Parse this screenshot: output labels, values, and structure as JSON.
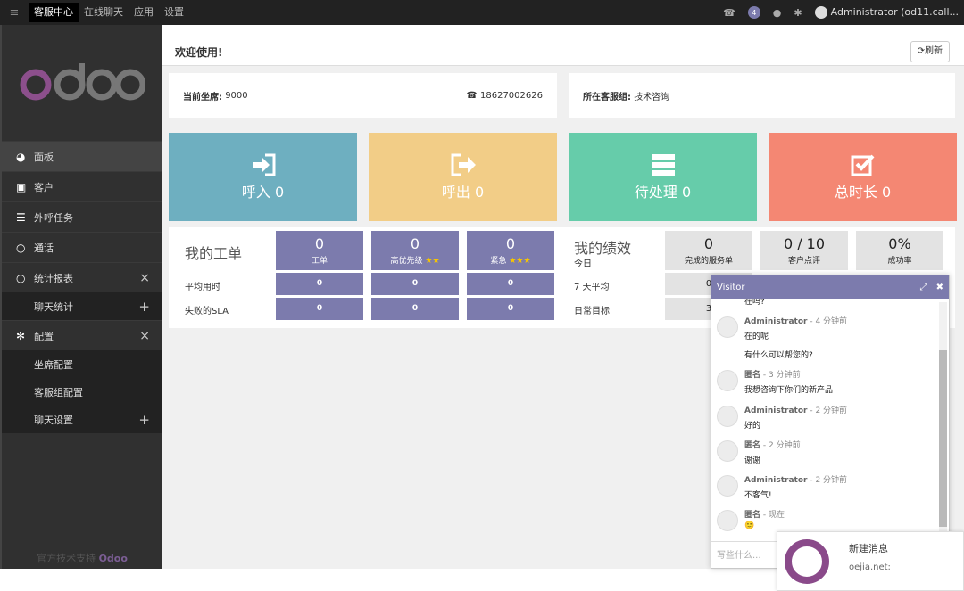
{
  "topbar": {
    "apps": [
      "客服中心",
      "在线聊天",
      "应用",
      "设置"
    ],
    "badge_count": "4",
    "user": "Administrator (od11.call..."
  },
  "sidebar": {
    "logo": "odoo",
    "items": [
      {
        "label": "面板",
        "icon": "dashboard-icon"
      },
      {
        "label": "客户",
        "icon": "contact-icon"
      },
      {
        "label": "外呼任务",
        "icon": "list-icon"
      },
      {
        "label": "通话",
        "icon": "circle-icon"
      },
      {
        "label": "统计报表",
        "icon": "circle-icon",
        "action": "×"
      },
      {
        "label": "聊天统计",
        "sub": true,
        "action": "+"
      },
      {
        "label": "配置",
        "icon": "gear-icon",
        "action": "×"
      },
      {
        "label": "坐席配置",
        "sub": true
      },
      {
        "label": "客服组配置",
        "sub": true
      },
      {
        "label": "聊天设置",
        "sub": true,
        "action": "+"
      }
    ],
    "footer_prefix": "官方技术支持",
    "footer_brand": "Odoo"
  },
  "main": {
    "title": "欢迎使用!",
    "refresh_label": "刷新",
    "seat_label": "当前坐席:",
    "seat_value": "9000",
    "phone": "18627002626",
    "group_label": "所在客服组:",
    "group_value": "技术咨询"
  },
  "tiles": [
    {
      "label": "呼入 0",
      "color": "#6eafc0"
    },
    {
      "label": "呼出 0",
      "color": "#f2cd87"
    },
    {
      "label": "待处理 0",
      "color": "#66ccaa"
    },
    {
      "label": "总时长 0",
      "color": "#f48773"
    }
  ],
  "tickets": {
    "title": "我的工单",
    "columns": [
      {
        "value": "0",
        "label": "工单",
        "stars": ""
      },
      {
        "value": "0",
        "label": "高优先级",
        "stars": "★★"
      },
      {
        "value": "0",
        "label": "紧急",
        "stars": "★★★"
      }
    ],
    "rows": [
      {
        "label": "平均用时",
        "values": [
          "0",
          "0",
          "0"
        ]
      },
      {
        "label": "失败的SLA",
        "values": [
          "0",
          "0",
          "0"
        ]
      }
    ]
  },
  "performance": {
    "title": "我的绩效",
    "today": "今日",
    "columns": [
      {
        "value": "0",
        "label": "完成的服务单"
      },
      {
        "value": "0 / 10",
        "label": "客户点评"
      },
      {
        "value": "0%",
        "label": "成功率"
      }
    ],
    "rows": [
      {
        "label": "7 天平均",
        "values": [
          "0"
        ]
      },
      {
        "label": "日常目标",
        "values": [
          "3"
        ]
      }
    ]
  },
  "chat": {
    "title": "Visitor",
    "partial_text": "在吗?",
    "messages": [
      {
        "author": "Administrator",
        "time": "4 分钟前",
        "lines": [
          "在的呢",
          "有什么可以帮您的?"
        ]
      },
      {
        "author": "匿名",
        "time": "3 分钟前",
        "lines": [
          "我想咨询下你们的新产品"
        ]
      },
      {
        "author": "Administrator",
        "time": "2 分钟前",
        "lines": [
          "好的"
        ]
      },
      {
        "author": "匿名",
        "time": "2 分钟前",
        "lines": [
          "谢谢"
        ]
      },
      {
        "author": "Administrator",
        "time": "2 分钟前",
        "lines": [
          "不客气!"
        ]
      },
      {
        "author": "匿名",
        "time": "现在",
        "lines": [
          "🙂"
        ]
      }
    ],
    "placeholder": "写些什么..."
  },
  "notification": {
    "title": "新建消息",
    "body": "oejia.net:"
  }
}
